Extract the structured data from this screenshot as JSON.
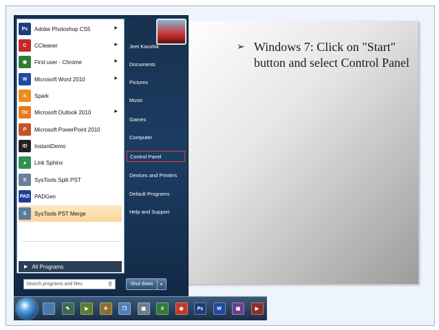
{
  "slide": {
    "bullet_text": "Windows 7:  Click on \"Start\" button and select Control Panel"
  },
  "start_menu": {
    "programs": [
      {
        "label": "Adobe Photoshop CS5",
        "icon": "photoshop-icon",
        "color": "#1b3f7a",
        "glyph": "Ps",
        "has_submenu": true
      },
      {
        "label": "CCleaner",
        "icon": "ccleaner-icon",
        "color": "#c62828",
        "glyph": "C",
        "has_submenu": true
      },
      {
        "label": "First user - Chrome",
        "icon": "chrome-icon",
        "color": "#2e7d32",
        "glyph": "◉",
        "has_submenu": true
      },
      {
        "label": "Microsoft Word 2010",
        "icon": "word-icon",
        "color": "#1e4aa0",
        "glyph": "W",
        "has_submenu": true
      },
      {
        "label": "Spark",
        "icon": "spark-icon",
        "color": "#ef8a1f",
        "glyph": "♨",
        "has_submenu": false
      },
      {
        "label": "Microsoft Outlook 2010",
        "icon": "outlook-icon",
        "color": "#e57c1c",
        "glyph": "Oz",
        "has_submenu": true
      },
      {
        "label": "Microsoft PowerPoint 2010",
        "icon": "powerpoint-icon",
        "color": "#c8512a",
        "glyph": "P",
        "has_submenu": false
      },
      {
        "label": "InstantDemo",
        "icon": "instantdemo-icon",
        "color": "#222222",
        "glyph": "ID",
        "has_submenu": false
      },
      {
        "label": "Link Sphinx",
        "icon": "linksphinx-icon",
        "color": "#2f8f4e",
        "glyph": "▲",
        "has_submenu": false
      },
      {
        "label": "SysTools Split PST",
        "icon": "systools-split-icon",
        "color": "#6a7f99",
        "glyph": "S",
        "has_submenu": false
      },
      {
        "label": "PADGen",
        "icon": "padgen-icon",
        "color": "#1b3f9a",
        "glyph": "PAD",
        "has_submenu": false
      },
      {
        "label": "SysTools PST Merge",
        "icon": "systools-merge-icon",
        "color": "#5d7b9c",
        "glyph": "S",
        "has_submenu": false
      }
    ],
    "all_programs": "All Programs",
    "search_placeholder": "Search programs and files",
    "right_items": [
      {
        "label": "Jeet Kaushik",
        "boxed": false
      },
      {
        "label": "Documents",
        "boxed": false
      },
      {
        "label": "Pictures",
        "boxed": false
      },
      {
        "label": "Music",
        "boxed": false
      },
      {
        "label": "Games",
        "boxed": false
      },
      {
        "label": "Computer",
        "boxed": false
      },
      {
        "label": "Control Panel",
        "boxed": true
      },
      {
        "label": "Devices and Printers",
        "boxed": false
      },
      {
        "label": "Default Programs",
        "boxed": false
      },
      {
        "label": "Help and Support",
        "boxed": false
      }
    ],
    "shutdown_label": "Shut down",
    "highlight_color": "#e23a3a"
  },
  "taskbar": {
    "icons": [
      {
        "name": "explorer-window-icon",
        "color": "#4a78a8",
        "glyph": ""
      },
      {
        "name": "tool-icon",
        "color": "#3b6a50",
        "glyph": "✎"
      },
      {
        "name": "media-icon",
        "color": "#5b7d2e",
        "glyph": "▶"
      },
      {
        "name": "network-icon",
        "color": "#8a6d2e",
        "glyph": "✣"
      },
      {
        "name": "files-icon",
        "color": "#4b82b8",
        "glyph": "❐"
      },
      {
        "name": "calculator-icon",
        "color": "#6b7d8f",
        "glyph": "▦"
      },
      {
        "name": "excel-icon",
        "color": "#2f7a3a",
        "glyph": "X"
      },
      {
        "name": "chrome-icon",
        "color": "#c0392b",
        "glyph": "◉"
      },
      {
        "name": "photoshop-icon",
        "color": "#1b3f7a",
        "glyph": "Ps"
      },
      {
        "name": "word-icon",
        "color": "#1e4aa0",
        "glyph": "W"
      },
      {
        "name": "app-icon",
        "color": "#6a3f8f",
        "glyph": "▣"
      },
      {
        "name": "player-icon",
        "color": "#8a2e2e",
        "glyph": "▶"
      }
    ]
  }
}
